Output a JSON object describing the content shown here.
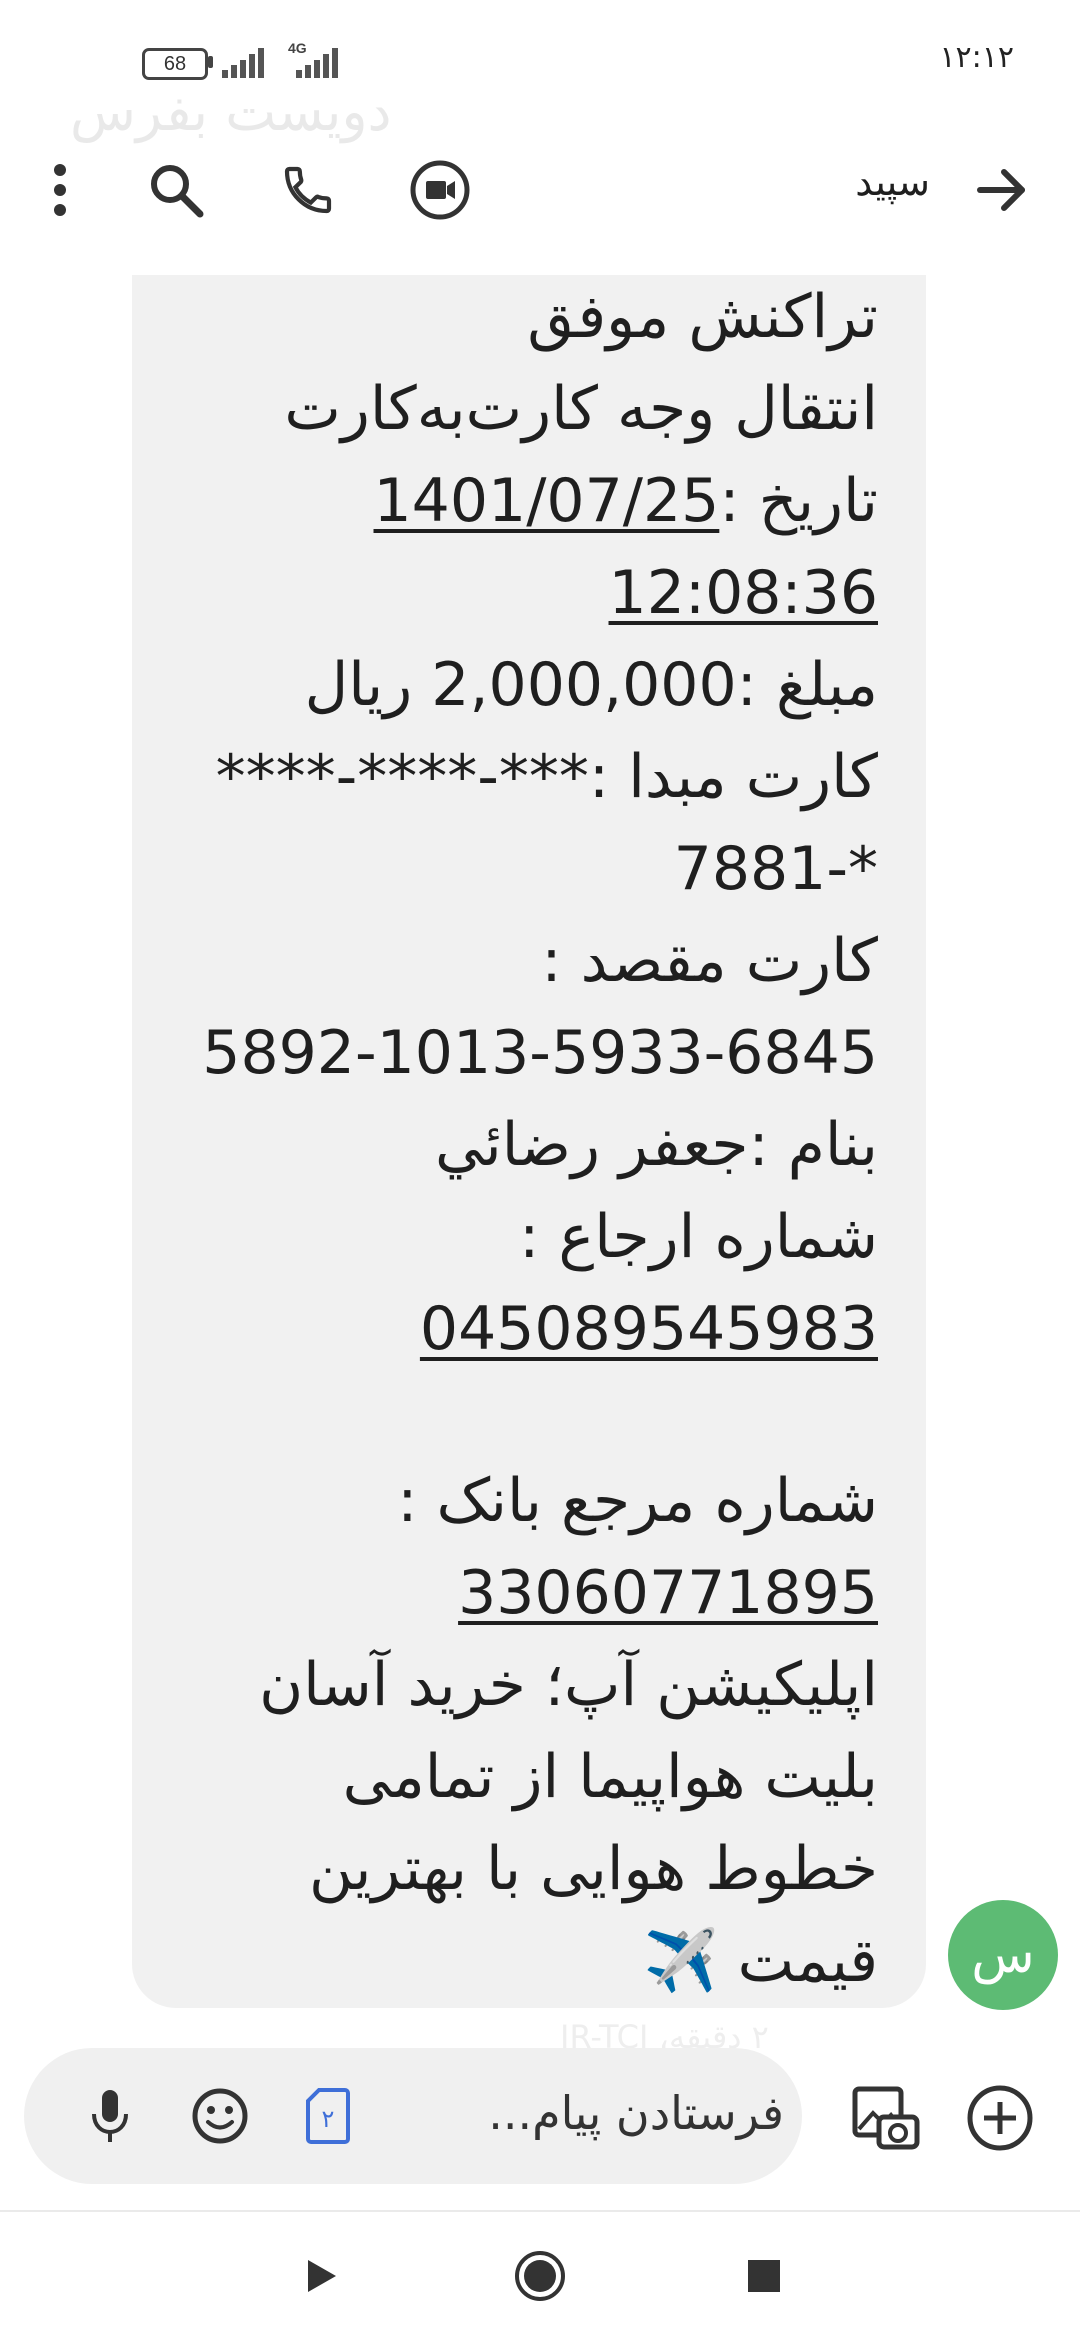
{
  "status": {
    "time": "۱۲:۱۲",
    "battery": "68",
    "network": "4G"
  },
  "background_title": "دویست بفرس",
  "header": {
    "contact_name": "سپید",
    "icons": [
      "back-arrow-icon",
      "video-call-icon",
      "phone-icon",
      "search-icon",
      "more-vert-icon"
    ]
  },
  "message": {
    "line1": "تراکنش موفق",
    "line2": "انتقال وجه کارت‌به‌کارت",
    "date_label": "تاریخ :",
    "date_value": "1401/07/25",
    "time_value": "12:08:36",
    "amount_line": "مبلغ :2,000,000 ريال",
    "source_card_line": "کارت مبدا :***-****-****",
    "source_card_tail": "*-7881",
    "dest_label": "کارت مقصد :",
    "dest_card": "5892-1013-5933-6845",
    "name_line": "بنام :جعفر رضائي",
    "ref_label": "شماره ارجاع :",
    "ref_value": "045089545983",
    "bank_ref_label": "شماره مرجع بانک :",
    "bank_ref_value": "33060771895",
    "ad_line1": "اپلیکیشن آپ؛ خرید آسان",
    "ad_line2": "بلیت هواپیما از تمامی",
    "ad_line3": "خطوط هوایی با بهترین",
    "ad_line4": "قیمت ✈️"
  },
  "avatar_letter": "س",
  "background_timestamp": "۲ دقیقه، IR-TCI",
  "composer": {
    "placeholder": "فرستادن پیام...",
    "sim_number": "۲"
  },
  "colors": {
    "bubble": "#f1f1f1",
    "avatar": "#5dbb74",
    "sim_icon": "#3f6fd8"
  }
}
